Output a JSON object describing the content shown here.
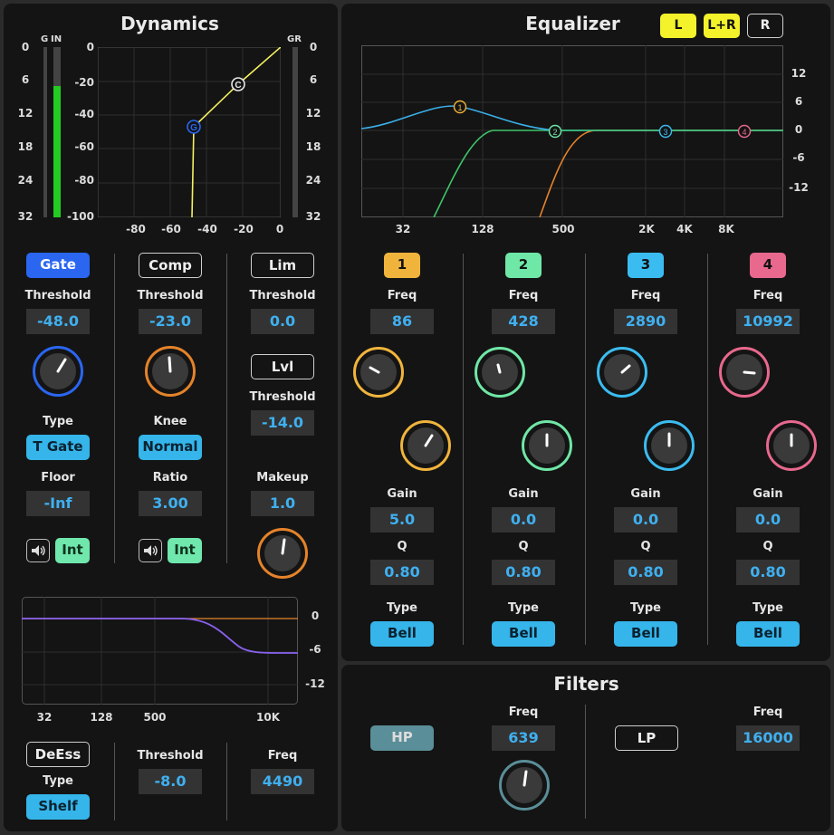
{
  "dynamics": {
    "title": "Dynamics",
    "meter": {
      "g_label": "G",
      "in_label": "IN",
      "gr_label": "GR",
      "scale": [
        "0",
        "6",
        "12",
        "18",
        "24",
        "32"
      ],
      "in_level": 0.77
    },
    "curve": {
      "y_ticks": [
        "0",
        "-20",
        "-40",
        "-60",
        "-80",
        "-100"
      ],
      "x_ticks": [
        "-80",
        "-60",
        "-40",
        "-20",
        "0"
      ],
      "gate_marker": "G",
      "comp_marker": "C"
    },
    "gate": {
      "button": "Gate",
      "threshold_label": "Threshold",
      "threshold": "-48.0",
      "type_label": "Type",
      "type": "T Gate",
      "floor_label": "Floor",
      "floor": "-Inf",
      "int": "Int",
      "speaker_icon": "speaker-icon"
    },
    "comp": {
      "button": "Comp",
      "threshold_label": "Threshold",
      "threshold": "-23.0",
      "knee_label": "Knee",
      "knee": "Normal",
      "ratio_label": "Ratio",
      "ratio": "3.00",
      "int": "Int",
      "speaker_icon": "speaker-icon"
    },
    "lim": {
      "button": "Lim",
      "threshold_label": "Threshold",
      "threshold": "0.0",
      "lvl_button": "Lvl",
      "lvl_threshold_label": "Threshold",
      "lvl_threshold": "-14.0",
      "makeup_label": "Makeup",
      "makeup": "1.0"
    },
    "deess_graph": {
      "y_ticks": [
        "0",
        "-6",
        "-12"
      ],
      "x_ticks": [
        "32",
        "128",
        "500",
        "10K"
      ]
    },
    "deess": {
      "button": "DeEss",
      "type_label": "Type",
      "type": "Shelf",
      "threshold_label": "Threshold",
      "threshold": "-8.0",
      "freq_label": "Freq",
      "freq": "4490"
    }
  },
  "equalizer": {
    "title": "Equalizer",
    "channels": [
      "L",
      "L+R",
      "R"
    ],
    "graph": {
      "y_ticks": [
        "12",
        "6",
        "0",
        "-6",
        "-12"
      ],
      "x_ticks": [
        "32",
        "128",
        "500",
        "2K",
        "4K",
        "8K"
      ],
      "markers": [
        "1",
        "2",
        "3",
        "4"
      ]
    },
    "bands": [
      {
        "num": "1",
        "freq_label": "Freq",
        "freq": "86",
        "gain_label": "Gain",
        "gain": "5.0",
        "q_label": "Q",
        "q": "0.80",
        "type_label": "Type",
        "type": "Bell",
        "color": "#f0b43c"
      },
      {
        "num": "2",
        "freq_label": "Freq",
        "freq": "428",
        "gain_label": "Gain",
        "gain": "0.0",
        "q_label": "Q",
        "q": "0.80",
        "type_label": "Type",
        "type": "Bell",
        "color": "#6fe7a6"
      },
      {
        "num": "3",
        "freq_label": "Freq",
        "freq": "2890",
        "gain_label": "Gain",
        "gain": "0.0",
        "q_label": "Q",
        "q": "0.80",
        "type_label": "Type",
        "type": "Bell",
        "color": "#3bbcf0"
      },
      {
        "num": "4",
        "freq_label": "Freq",
        "freq": "10992",
        "gain_label": "Gain",
        "gain": "0.0",
        "q_label": "Q",
        "q": "0.80",
        "type_label": "Type",
        "type": "Bell",
        "color": "#e8688e"
      }
    ]
  },
  "filters": {
    "title": "Filters",
    "hp": {
      "button": "HP",
      "freq_label": "Freq",
      "freq": "639"
    },
    "lp": {
      "button": "LP",
      "freq_label": "Freq",
      "freq": "16000"
    }
  },
  "colors": {
    "accent_blue": "#3fb0f0",
    "gate_blue": "#2a66f0",
    "comp_orange": "#e5832a",
    "meter_green": "#22cc22",
    "curve_yellow": "#f4f060"
  }
}
